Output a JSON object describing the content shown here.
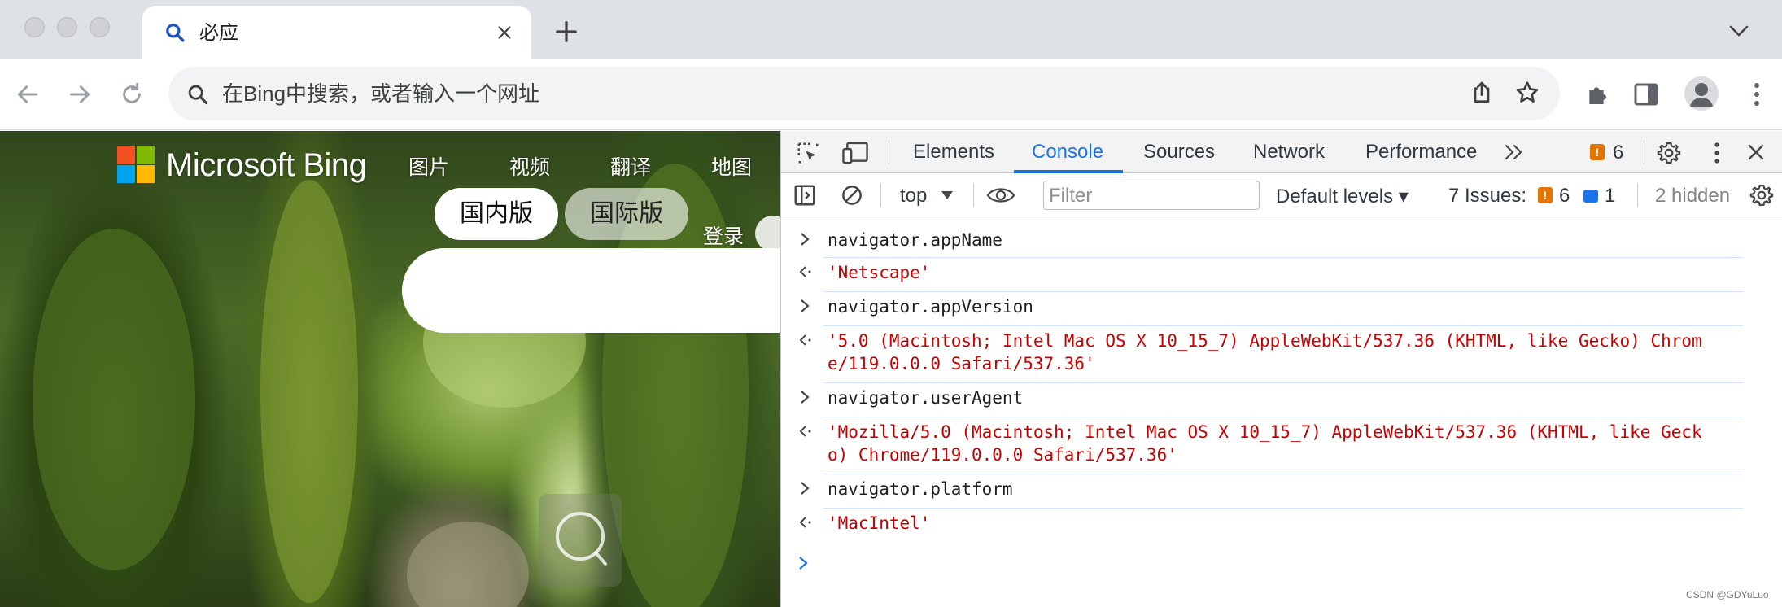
{
  "browser": {
    "tab": {
      "title": "必应",
      "icon": "search-icon"
    },
    "omnibox": {
      "placeholder": "在Bing中搜索，或者输入一个网址"
    }
  },
  "bing": {
    "brand": "Microsoft Bing",
    "nav": [
      "图片",
      "视频",
      "翻译",
      "地图"
    ],
    "region_tabs": [
      "国内版",
      "国际版"
    ],
    "login": "登录"
  },
  "devtools": {
    "tabs": [
      "Elements",
      "Console",
      "Sources",
      "Network",
      "Performance"
    ],
    "active_tab": "Console",
    "issue_count_top": "6",
    "toolbar": {
      "context": "top",
      "filter_placeholder": "Filter",
      "levels": "Default levels ▾",
      "issues_label": "7 Issues:",
      "issues_warn": "6",
      "issues_info": "1",
      "hidden": "2 hidden"
    },
    "console": [
      {
        "type": "input",
        "text": "navigator.appName"
      },
      {
        "type": "result",
        "text": "'Netscape'"
      },
      {
        "type": "input",
        "text": "navigator.appVersion"
      },
      {
        "type": "result",
        "text": "'5.0 (Macintosh; Intel Mac OS X 10_15_7) AppleWebKit/537.36 (KHTML, like Gecko) Chrom\ne/119.0.0.0 Safari/537.36'"
      },
      {
        "type": "input",
        "text": "navigator.userAgent"
      },
      {
        "type": "result",
        "text": "'Mozilla/5.0 (Macintosh; Intel Mac OS X 10_15_7) AppleWebKit/537.36 (KHTML, like Geck\no) Chrome/119.0.0.0 Safari/537.36'"
      },
      {
        "type": "input",
        "text": "navigator.platform"
      },
      {
        "type": "result",
        "text": "'MacIntel'"
      }
    ]
  },
  "colors": {
    "accent": "#1a73e8",
    "result_text": "#c80000",
    "warning": "#e37400"
  },
  "watermark": "CSDN @GDYuLuo"
}
